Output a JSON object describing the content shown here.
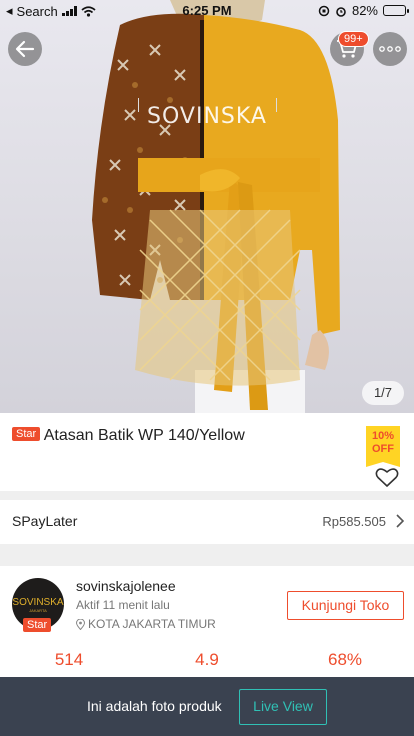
{
  "status_bar": {
    "back_app": "Search",
    "time": "6:25 PM",
    "battery": "82%"
  },
  "header": {
    "cart_badge": "99+"
  },
  "product_image": {
    "watermark": "SOVINSKA",
    "counter": "1/7"
  },
  "product": {
    "badge": "Star",
    "title": "Atasan Batik WP 140/Yellow",
    "discount_percent": "10%",
    "discount_label": "OFF"
  },
  "paylater": {
    "label": "SPayLater",
    "value": "Rp585.505"
  },
  "shop": {
    "avatar_text": "SOVINSKA",
    "avatar_subtext": "JAKARTA",
    "badge": "Star",
    "name": "sovinskajolenee",
    "active": "Aktif 11 menit lalu",
    "location": "KOTA JAKARTA TIMUR",
    "visit_label": "Kunjungi Toko",
    "stats": [
      "514",
      "4.9",
      "68%"
    ]
  },
  "live_bar": {
    "message": "Ini adalah foto produk",
    "button": "Live View"
  },
  "colors": {
    "accent": "#ee4d2d",
    "teal": "#30c0b5",
    "mustard": "#e8a91f"
  }
}
